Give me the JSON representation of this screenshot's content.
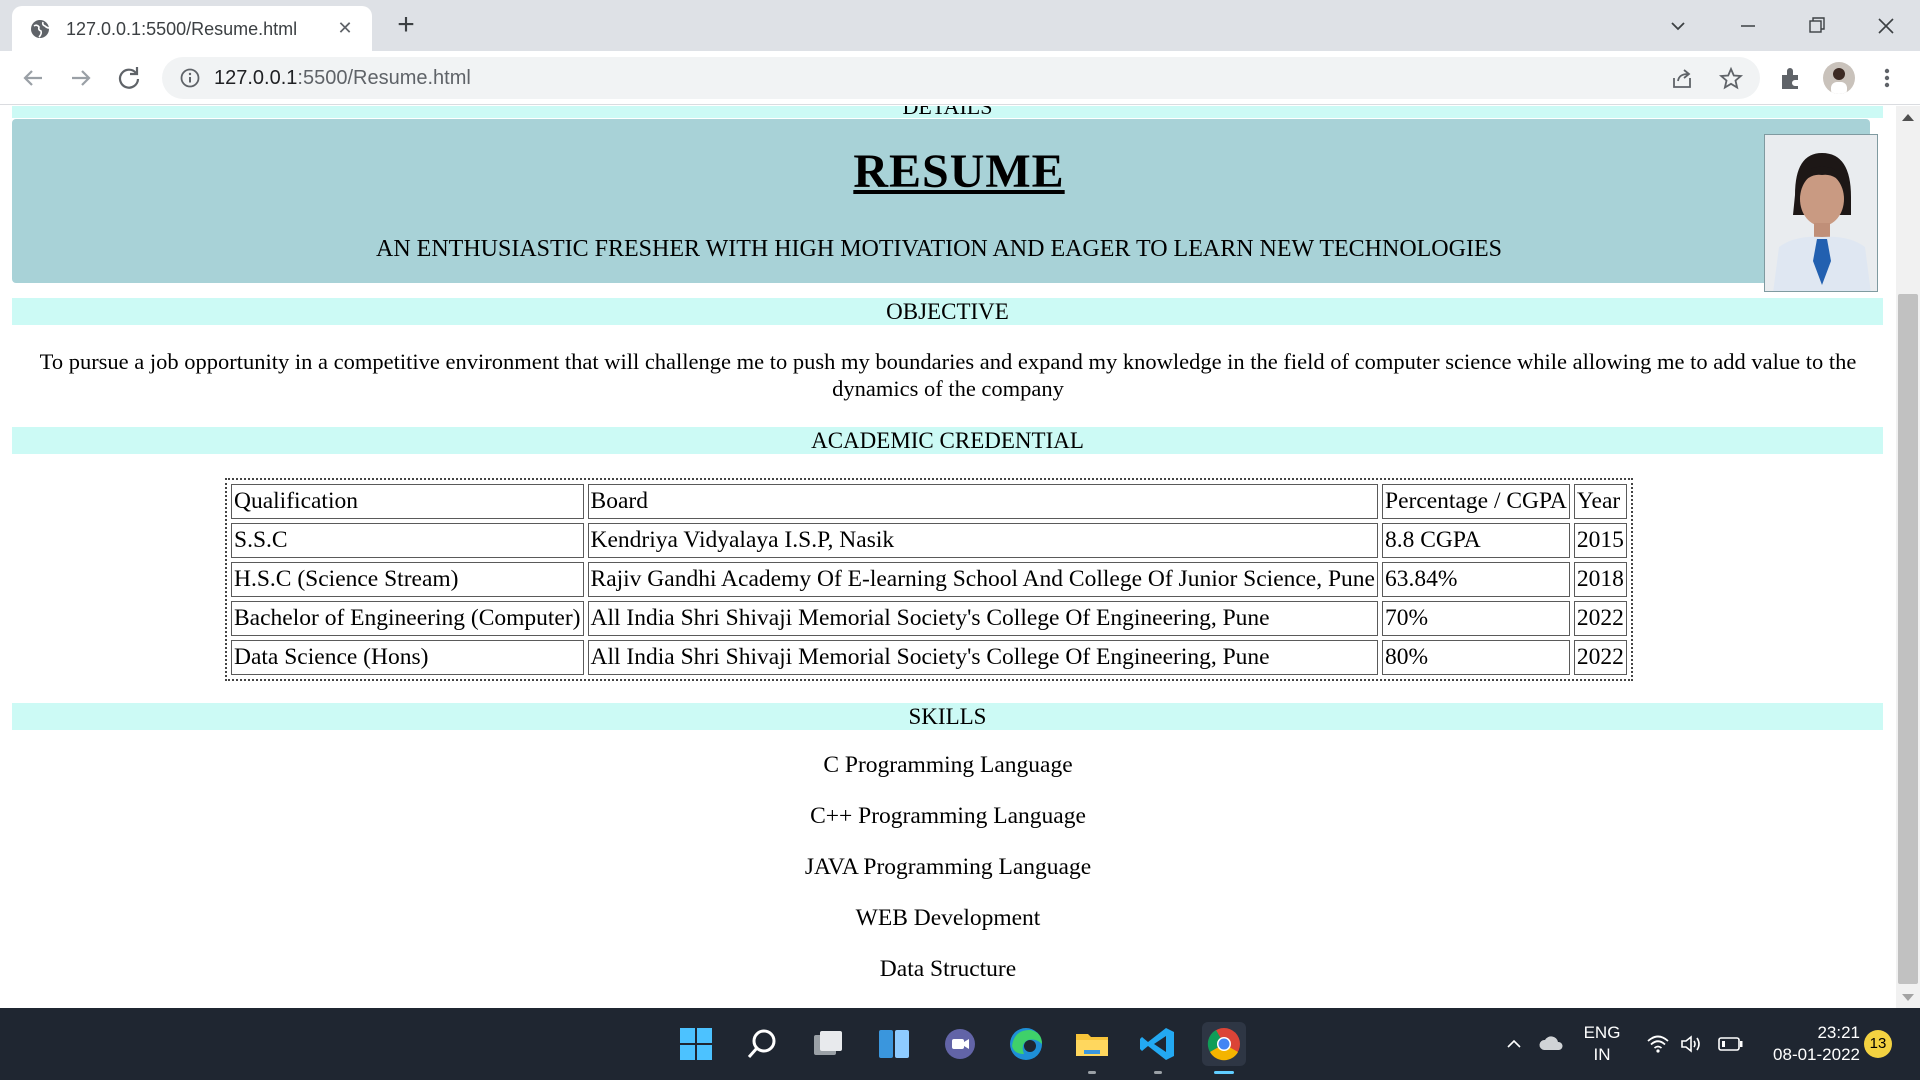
{
  "browser": {
    "tab_title": "127.0.0.1:5500/Resume.html",
    "tab_close": "✕",
    "new_tab": "+",
    "url_host": "127.0.0.1",
    "url_path": ":5500/Resume.html"
  },
  "page": {
    "previous_heading": "DETAILS",
    "title": "RESUME",
    "tagline": "AN ENTHUSIASTIC FRESHER WITH HIGH MOTIVATION AND EAGER TO LEARN NEW TECHNOLOGIES",
    "objective": {
      "heading": "OBJECTIVE",
      "text": "To pursue a job opportunity in a competitive environment that will challenge me to push my boundaries and expand my knowledge in the field of computer science while allowing me to add value to the dynamics of the company"
    },
    "academic": {
      "heading": "ACADEMIC CREDENTIAL",
      "headers": [
        "Qualification",
        "Board",
        "Percentage / CGPA",
        "Year"
      ],
      "rows": [
        [
          "S.S.C",
          "Kendriya Vidyalaya I.S.P, Nasik",
          "8.8 CGPA",
          "2015"
        ],
        [
          "H.S.C (Science Stream)",
          "Rajiv Gandhi Academy Of E-learning School And College Of Junior Science, Pune",
          "63.84%",
          "2018"
        ],
        [
          "Bachelor of Engineering (Computer)",
          "All India Shri Shivaji Memorial Society's College Of Engineering, Pune",
          "70%",
          "2022"
        ],
        [
          "Data Science (Hons)",
          "All India Shri Shivaji Memorial Society's College Of Engineering, Pune",
          "80%",
          "2022"
        ]
      ]
    },
    "skills": {
      "heading": "SKILLS",
      "items": [
        "C Programming Language",
        "C++ Programming Language",
        "JAVA Programming Language",
        "WEB Development",
        "Data Structure"
      ]
    }
  },
  "taskbar": {
    "language": "ENG",
    "region": "IN",
    "time": "23:21",
    "date": "08-01-2022",
    "notifications": "13"
  },
  "colors": {
    "header_bg": "#a8d2d7",
    "band_bg": "#ccfaf5",
    "taskbar_bg": "#1f2631",
    "tab_strip_bg": "#dee1e6"
  }
}
